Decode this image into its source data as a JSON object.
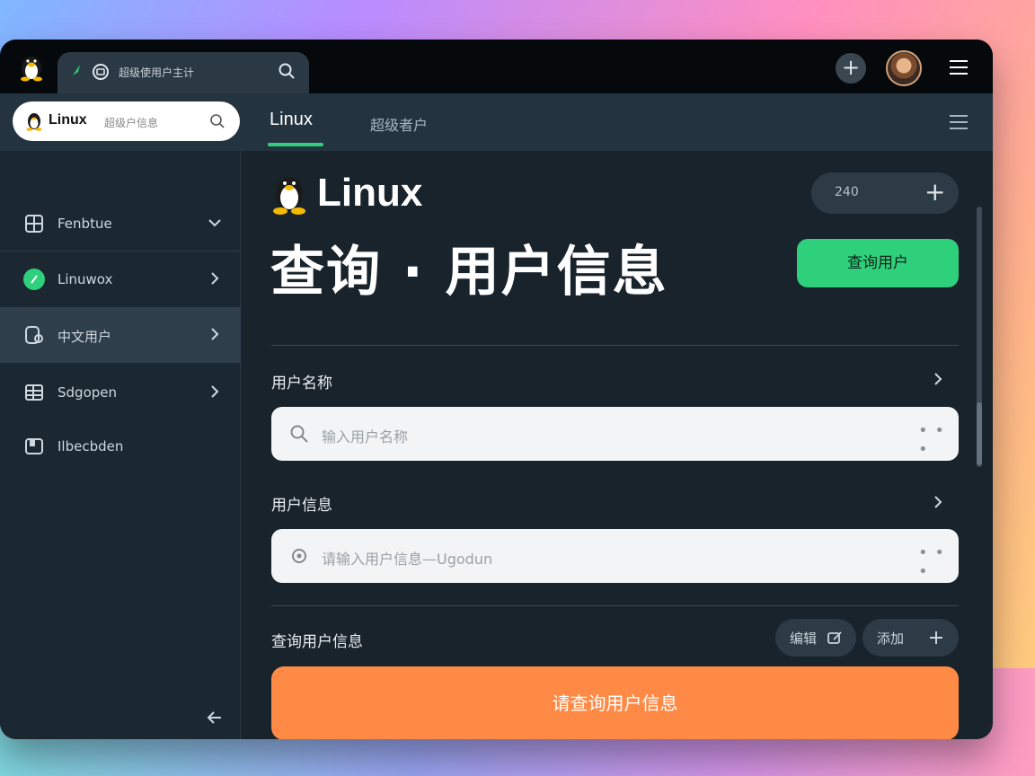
{
  "topbar": {
    "tab_title": "超级使用户主计",
    "plus_label": "+"
  },
  "navbar": {
    "search_brand": "Linux",
    "search_placeholder": "超级户信息",
    "tabs": [
      {
        "label": "Linux",
        "active": true
      },
      {
        "label": "超级者户"
      }
    ]
  },
  "sidebar": {
    "items": [
      {
        "label": "Fenbtue",
        "icon": "grid-icon",
        "chevron": "chevron-down-icon"
      },
      {
        "label": "Linuwox",
        "icon": "green-dot-icon",
        "chevron": "chevron-right-icon"
      },
      {
        "label": "中文用户",
        "icon": "user-card-icon",
        "chevron": "chevron-right-icon",
        "active": true
      },
      {
        "label": "Sdgopen",
        "icon": "list-icon",
        "chevron": "chevron-right-icon"
      },
      {
        "label": "Ilbecbden",
        "icon": "tray-icon"
      }
    ]
  },
  "main": {
    "brand": "Linux",
    "title": "查询 · 用户信息",
    "counter_value": "240",
    "green_button": "查询用户",
    "section1_label": "用户名称",
    "input1_placeholder": "输入用户名称",
    "section2_label": "用户信息",
    "input2_placeholder": "请输入用户信息—Ugodun",
    "section3_label": "查询用户信息",
    "pill1": "编辑",
    "pill2": "添加",
    "orange_button": "请查询用户信息"
  },
  "colors": {
    "accent_green": "#2fd07c",
    "accent_orange": "#ff8a45",
    "window_bg": "#18232c"
  }
}
